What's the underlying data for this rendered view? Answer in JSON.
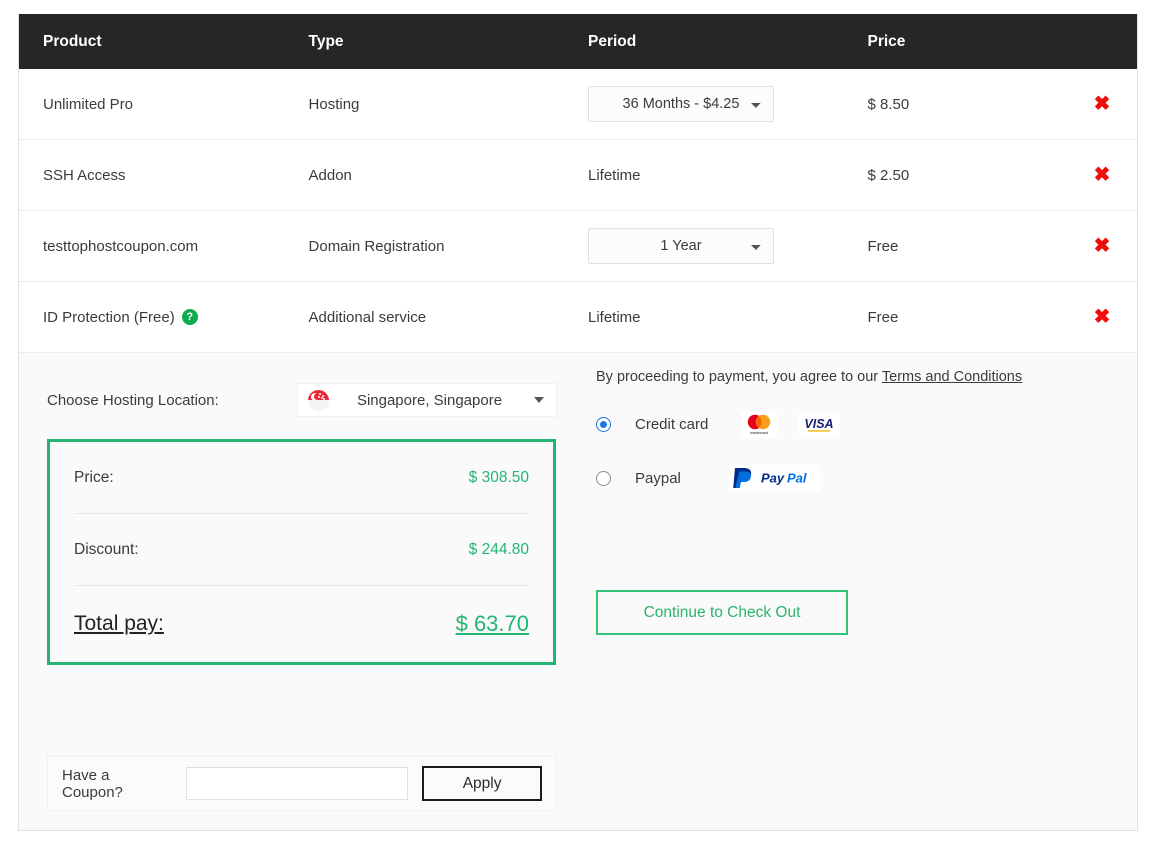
{
  "table": {
    "columns": [
      "Product",
      "Type",
      "Period",
      "Price"
    ],
    "rows": [
      {
        "product": "Unlimited Pro",
        "type": "Hosting",
        "period": "36 Months - $4.25",
        "period_is_select": true,
        "price": "$ 8.50",
        "remove_icon": "remove-x-icon",
        "has_help": false
      },
      {
        "product": "SSH Access",
        "type": "Addon",
        "period": "Lifetime",
        "period_is_select": false,
        "price": "$ 2.50",
        "remove_icon": "remove-x-icon",
        "has_help": false
      },
      {
        "product": "testtophostcoupon.com",
        "type": "Domain Registration",
        "period": "1 Year",
        "period_is_select": true,
        "price": "Free",
        "remove_icon": "remove-x-icon",
        "has_help": false
      },
      {
        "product": "ID Protection (Free)",
        "type": "Additional service",
        "period": "Lifetime",
        "period_is_select": false,
        "price": "Free",
        "remove_icon": "remove-x-icon",
        "has_help": true,
        "help_glyph": "?"
      }
    ]
  },
  "location": {
    "label": "Choose Hosting Location:",
    "selected": "Singapore, Singapore",
    "flag_icon": "singapore-flag-icon"
  },
  "totals": {
    "price_label": "Price:",
    "price_value": "$ 308.50",
    "discount_label": "Discount:",
    "discount_value": "$ 244.80",
    "total_label": "Total pay:",
    "total_value": "$ 63.70",
    "accent_color": "#22b573"
  },
  "coupon": {
    "label": "Have a Coupon?",
    "value": "",
    "placeholder": "",
    "apply_label": "Apply"
  },
  "payment": {
    "terms_prefix": "By proceeding to payment, you agree to our ",
    "terms_link": "Terms and Conditions",
    "options": [
      {
        "label": "Credit card",
        "selected": true,
        "logos": [
          "mastercard-logo",
          "visa-logo"
        ]
      },
      {
        "label": "Paypal",
        "selected": false,
        "logos": [
          "paypal-logo"
        ]
      }
    ],
    "checkout_label": "Continue to Check Out"
  },
  "remove_glyph": "✖"
}
